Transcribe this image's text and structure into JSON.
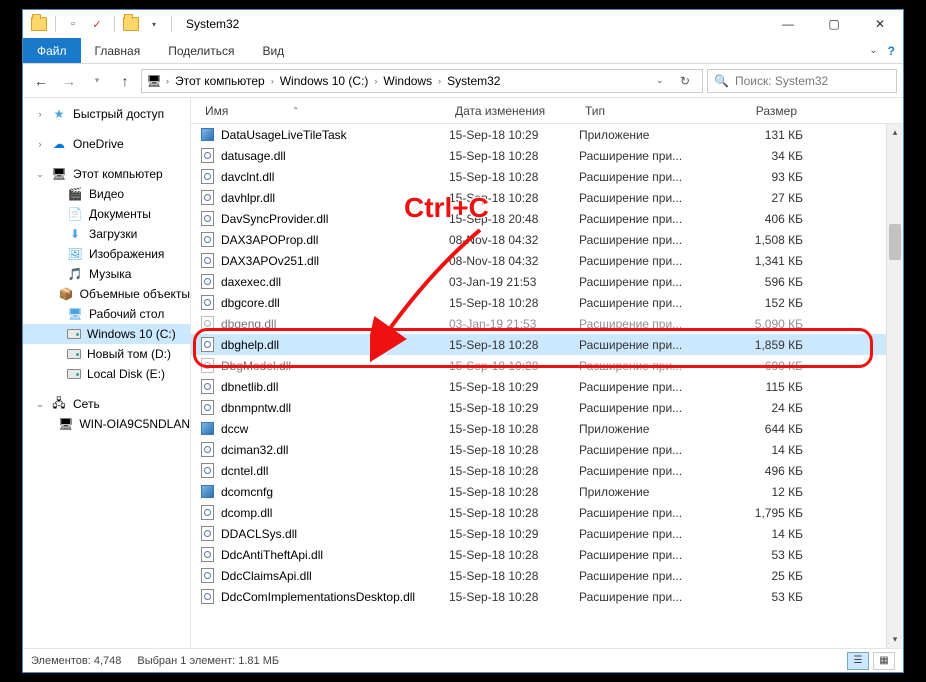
{
  "window": {
    "title": "System32"
  },
  "ribbon": {
    "file": "Файл",
    "tabs": [
      "Главная",
      "Поделиться",
      "Вид"
    ]
  },
  "breadcrumb": [
    "Этот компьютер",
    "Windows 10 (C:)",
    "Windows",
    "System32"
  ],
  "search": {
    "placeholder": "Поиск: System32"
  },
  "nav": {
    "quick": {
      "label": "Быстрый доступ"
    },
    "onedrive": {
      "label": "OneDrive"
    },
    "thispc": {
      "label": "Этот компьютер",
      "children": [
        {
          "label": "Видео"
        },
        {
          "label": "Документы"
        },
        {
          "label": "Загрузки"
        },
        {
          "label": "Изображения"
        },
        {
          "label": "Музыка"
        },
        {
          "label": "Объемные объекты"
        },
        {
          "label": "Рабочий стол"
        },
        {
          "label": "Windows 10 (C:)",
          "selected": true,
          "drive": true
        },
        {
          "label": "Новый том (D:)",
          "drive": true
        },
        {
          "label": "Local Disk (E:)",
          "drive": true
        }
      ]
    },
    "network": {
      "label": "Сеть",
      "children": [
        {
          "label": "WIN-OIA9C5NDLAN"
        }
      ]
    }
  },
  "columns": {
    "name": "Имя",
    "date": "Дата изменения",
    "type": "Тип",
    "size": "Размер"
  },
  "files": [
    {
      "icon": "app",
      "name": "DataUsageLiveTileTask",
      "date": "15-Sep-18 10:29",
      "type": "Приложение",
      "size": "131 КБ"
    },
    {
      "icon": "dll",
      "name": "datusage.dll",
      "date": "15-Sep-18 10:28",
      "type": "Расширение при...",
      "size": "34 КБ"
    },
    {
      "icon": "dll",
      "name": "davclnt.dll",
      "date": "15-Sep-18 10:28",
      "type": "Расширение при...",
      "size": "93 КБ"
    },
    {
      "icon": "dll",
      "name": "davhlpr.dll",
      "date": "15-Sep-18 10:28",
      "type": "Расширение при...",
      "size": "27 КБ"
    },
    {
      "icon": "dll",
      "name": "DavSyncProvider.dll",
      "date": "15-Sep-18 20:48",
      "type": "Расширение при...",
      "size": "406 КБ"
    },
    {
      "icon": "dll",
      "name": "DAX3APOProp.dll",
      "date": "08-Nov-18 04:32",
      "type": "Расширение при...",
      "size": "1,508 КБ"
    },
    {
      "icon": "dll",
      "name": "DAX3APOv251.dll",
      "date": "08-Nov-18 04:32",
      "type": "Расширение при...",
      "size": "1,341 КБ"
    },
    {
      "icon": "dll",
      "name": "daxexec.dll",
      "date": "03-Jan-19 21:53",
      "type": "Расширение при...",
      "size": "596 КБ"
    },
    {
      "icon": "dll",
      "name": "dbgcore.dll",
      "date": "15-Sep-18 10:28",
      "type": "Расширение при...",
      "size": "152 КБ"
    },
    {
      "icon": "dll",
      "name": "dbgeng.dll",
      "date": "03-Jan-19 21:53",
      "type": "Расширение при...",
      "size": "5,090 КБ",
      "dim": true
    },
    {
      "icon": "dll",
      "name": "dbghelp.dll",
      "date": "15-Sep-18 10:28",
      "type": "Расширение при...",
      "size": "1,859 КБ",
      "selected": true
    },
    {
      "icon": "dll",
      "name": "DbgModel.dll",
      "date": "15-Sep-18 10:28",
      "type": "Расширение при...",
      "size": "690 КБ",
      "dim": true
    },
    {
      "icon": "dll",
      "name": "dbnetlib.dll",
      "date": "15-Sep-18 10:29",
      "type": "Расширение при...",
      "size": "115 КБ"
    },
    {
      "icon": "dll",
      "name": "dbnmpntw.dll",
      "date": "15-Sep-18 10:29",
      "type": "Расширение при...",
      "size": "24 КБ"
    },
    {
      "icon": "app",
      "name": "dccw",
      "date": "15-Sep-18 10:28",
      "type": "Приложение",
      "size": "644 КБ"
    },
    {
      "icon": "dll",
      "name": "dciman32.dll",
      "date": "15-Sep-18 10:28",
      "type": "Расширение при...",
      "size": "14 КБ"
    },
    {
      "icon": "dll",
      "name": "dcntel.dll",
      "date": "15-Sep-18 10:28",
      "type": "Расширение при...",
      "size": "496 КБ"
    },
    {
      "icon": "app",
      "name": "dcomcnfg",
      "date": "15-Sep-18 10:28",
      "type": "Приложение",
      "size": "12 КБ"
    },
    {
      "icon": "dll",
      "name": "dcomp.dll",
      "date": "15-Sep-18 10:28",
      "type": "Расширение при...",
      "size": "1,795 КБ"
    },
    {
      "icon": "dll",
      "name": "DDACLSys.dll",
      "date": "15-Sep-18 10:29",
      "type": "Расширение при...",
      "size": "14 КБ"
    },
    {
      "icon": "dll",
      "name": "DdcAntiTheftApi.dll",
      "date": "15-Sep-18 10:28",
      "type": "Расширение при...",
      "size": "53 КБ"
    },
    {
      "icon": "dll",
      "name": "DdcClaimsApi.dll",
      "date": "15-Sep-18 10:28",
      "type": "Расширение при...",
      "size": "25 КБ"
    },
    {
      "icon": "dll",
      "name": "DdcComImplementationsDesktop.dll",
      "date": "15-Sep-18 10:28",
      "type": "Расширение при...",
      "size": "53 КБ"
    }
  ],
  "status": {
    "items": "Элементов: 4,748",
    "selection": "Выбран 1 элемент: 1.81 МБ"
  },
  "annotation": {
    "text": "Ctrl+C"
  }
}
